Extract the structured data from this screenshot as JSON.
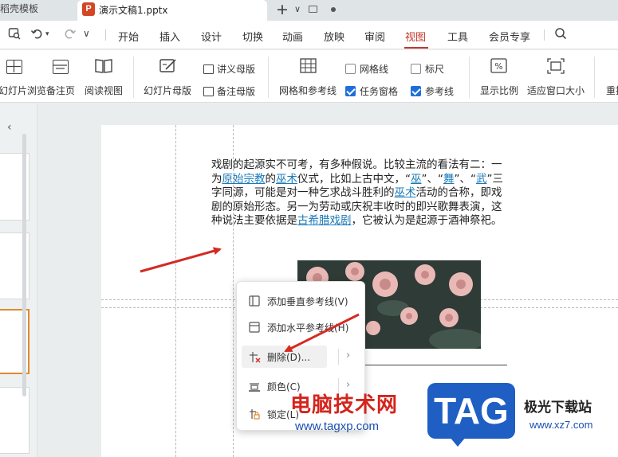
{
  "tabs": {
    "previous_tab": "找稻壳模板",
    "active_tab": "演示文稿1.pptx",
    "app_icon_letter": "P"
  },
  "menu": {
    "items": [
      "开始",
      "插入",
      "设计",
      "切换",
      "动画",
      "放映",
      "审阅",
      "视图",
      "工具",
      "会员专享"
    ],
    "active": "视图"
  },
  "ribbon": {
    "slide_browse": "幻灯片浏览",
    "notes_page": "备注页",
    "reading_view": "阅读视图",
    "slide_master": "幻灯片母版",
    "handout_master": "讲义母版",
    "notes_master": "备注母版",
    "grid_and_guides": "网格和参考线",
    "gridlines": "网格线",
    "ruler": "标尺",
    "task_pane": "任务窗格",
    "guides": "参考线",
    "display_ratio": "显示比例",
    "fit_window": "适应窗口大小",
    "rearrange": "重排",
    "gridlines_checked": false,
    "ruler_checked": false,
    "task_pane_checked": true,
    "guides_checked": true
  },
  "slide": {
    "paragraph": [
      {
        "t": "戏剧的起源实不可考，有多种假说。比较主流的看法有二：一为"
      },
      {
        "t": "原始宗教",
        "link": true
      },
      {
        "t": "的"
      },
      {
        "t": "巫术",
        "link": true
      },
      {
        "t": "仪式，比如上古中文，“"
      },
      {
        "t": "巫",
        "link": true
      },
      {
        "t": "”、“"
      },
      {
        "t": "舞",
        "link": true
      },
      {
        "t": "”、“"
      },
      {
        "t": "武",
        "link": true
      },
      {
        "t": "”三字同源，可能是对一种乞求战斗胜利的"
      },
      {
        "t": "巫术",
        "link": true
      },
      {
        "t": "活动的合称，即戏剧的原始形态。另一为劳动或庆祝丰收时的即兴歌舞表演，这种说法主要依据是"
      },
      {
        "t": "古希腊戏剧",
        "link": true
      },
      {
        "t": "，它被认为是起源于酒神祭祀。"
      }
    ]
  },
  "context_menu": {
    "add_vertical_guide": "添加垂直参考线(V)",
    "add_horizontal_guide": "添加水平参考线(H)",
    "delete": "删除(D)...",
    "color": "颜色(C)",
    "lock": "锁定(L)"
  },
  "watermark": {
    "cn_text": "电脑技术网",
    "url": "www.tagxp.com",
    "tag": "TAG",
    "site_name": "极光下载站",
    "site_url": "www.xz7.com"
  },
  "colors": {
    "accent_red": "#c0392b",
    "link_blue": "#1a7ab8",
    "checkbox_blue": "#1e6fd9",
    "annotation_red": "#d42a22"
  }
}
